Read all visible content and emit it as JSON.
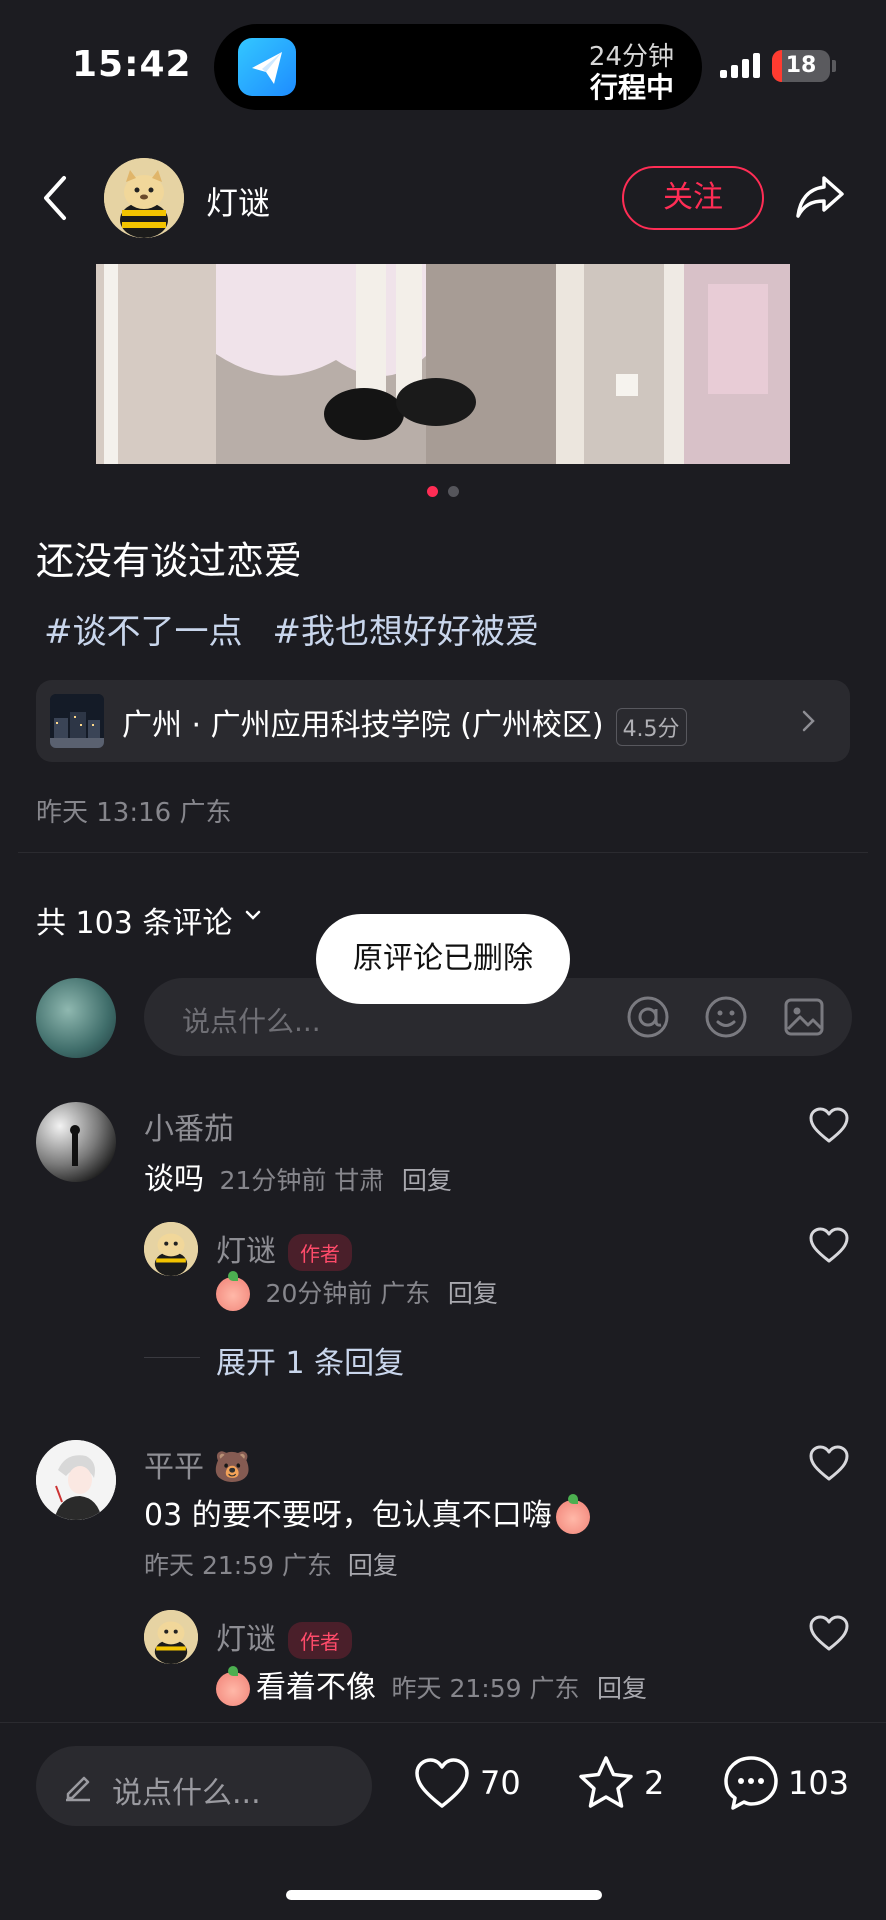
{
  "status_bar": {
    "time": "15:42",
    "activity_line1": "24分钟",
    "activity_line2": "行程中",
    "battery": "18",
    "battery_level": 0.18
  },
  "header": {
    "username": "灯谜",
    "follow_label": "关注"
  },
  "carousel": {
    "page_count": 2,
    "active_index": 0,
    "active_color": "#ff2d55",
    "inactive_color": "#55555b"
  },
  "post": {
    "title": "还没有谈过恋爱",
    "tags": [
      "#谈不了一点",
      "#我也想好好被爱"
    ],
    "location": "广州 · 广州应用科技学院 (广州校区)",
    "location_score": "4.5分",
    "meta": "昨天 13:16 广东"
  },
  "comments_section": {
    "count_label": "共 103 条评论",
    "toast": "原评论已删除",
    "input_placeholder": "说点什么..."
  },
  "comments": [
    {
      "name": "小番茄",
      "text": "谈吗",
      "meta": "21分钟前  甘肃",
      "reply_label": "回复",
      "reply": {
        "name": "灯谜",
        "badge": "作者",
        "meta": "20分钟前  广东",
        "reply_label": "回复"
      },
      "expand_label": "展开 1 条回复"
    },
    {
      "name": "平平 🐻",
      "text": "03 的要不要呀，包认真不口嗨",
      "meta": "昨天 21:59  广东",
      "reply_label": "回复",
      "reply": {
        "name": "灯谜",
        "badge": "作者",
        "text": "看着不像",
        "meta": "昨天 21:59  广东",
        "reply_label": "回复"
      }
    }
  ],
  "bottom_bar": {
    "input_placeholder": "说点什么...",
    "likes": "70",
    "stars": "2",
    "comments": "103"
  },
  "colors": {
    "background": "#1c1c21",
    "accent": "#ff2d55",
    "tag": "#c9d6ec"
  }
}
